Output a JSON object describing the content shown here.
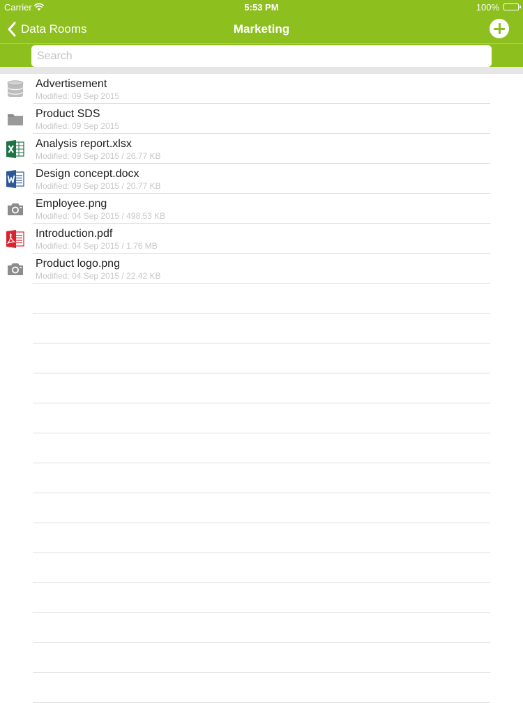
{
  "status_bar": {
    "carrier": "Carrier",
    "time": "5:53 PM",
    "battery": "100%"
  },
  "nav": {
    "back_label": "Data Rooms",
    "title": "Marketing"
  },
  "search": {
    "placeholder": "Search"
  },
  "colors": {
    "accent": "#8dbf1f",
    "excel": "#1f7244",
    "word": "#2b5797",
    "pdf": "#d9232e",
    "gray_icon": "#8c8c8c"
  },
  "items": [
    {
      "name": "Advertisement",
      "meta": "Modified: 09 Sep 2015",
      "icon": "database-icon"
    },
    {
      "name": "Product SDS",
      "meta": "Modified: 09 Sep 2015",
      "icon": "folder-icon"
    },
    {
      "name": "Analysis report.xlsx",
      "meta": "Modified: 09 Sep 2015 / 26.77 KB",
      "icon": "excel-icon"
    },
    {
      "name": "Design concept.docx",
      "meta": "Modified: 09 Sep 2015 / 20.77 KB",
      "icon": "word-icon"
    },
    {
      "name": "Employee.png",
      "meta": "Modified: 04 Sep 2015 / 498.53 KB",
      "icon": "camera-icon"
    },
    {
      "name": "Introduction.pdf",
      "meta": "Modified: 04 Sep 2015 / 1.76 MB",
      "icon": "pdf-icon"
    },
    {
      "name": "Product logo.png",
      "meta": "Modified: 04 Sep 2015 / 22.42 KB",
      "icon": "camera-icon"
    }
  ]
}
